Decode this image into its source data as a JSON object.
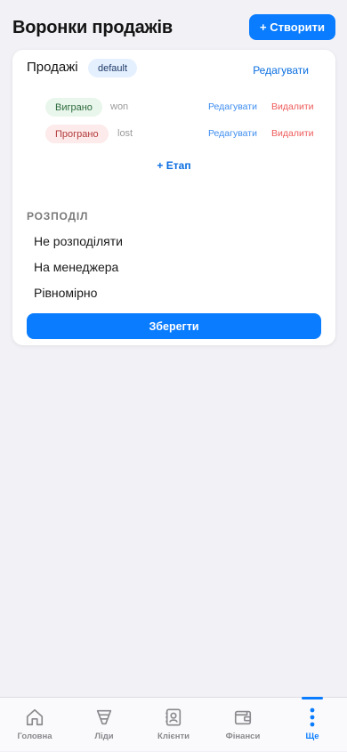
{
  "header": {
    "title": "Воронки продажів",
    "create_label": "+ Створити"
  },
  "funnel": {
    "name": "Продажі",
    "badge": "default",
    "edit_label": "Редагувати",
    "stages": [
      {
        "label": "Виграно",
        "code": "won",
        "edit_label": "Редагувати",
        "delete_label": "Видалити"
      },
      {
        "label": "Програно",
        "code": "lost",
        "edit_label": "Редагувати",
        "delete_label": "Видалити"
      }
    ],
    "add_stage_label": "+ Етап"
  },
  "distribution": {
    "section_label": "РОЗПОДІЛ",
    "options": [
      "Не розподіляти",
      "На менеджера",
      "Рівномірно"
    ],
    "save_label": "Зберегти"
  },
  "tabbar": {
    "items": [
      {
        "label": "Головна",
        "icon": "home-icon"
      },
      {
        "label": "Ліди",
        "icon": "funnel-icon"
      },
      {
        "label": "Клієнти",
        "icon": "contacts-icon"
      },
      {
        "label": "Фінанси",
        "icon": "wallet-icon"
      },
      {
        "label": "Ще",
        "icon": "more-icon"
      }
    ],
    "active": "Ще"
  },
  "colors": {
    "accent": "#0a7cff",
    "danger": "#ef5a5a",
    "background": "#f1f1f6"
  }
}
